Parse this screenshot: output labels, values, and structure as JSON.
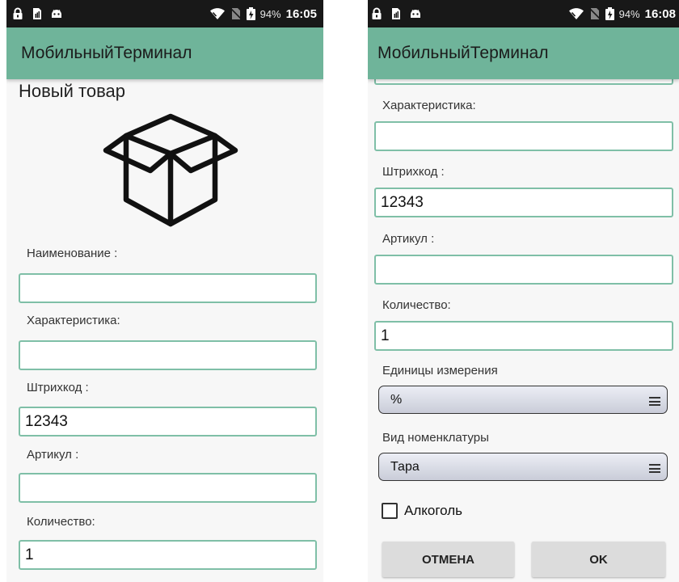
{
  "left": {
    "status": {
      "battery": "94%",
      "time": "16:05"
    },
    "app_title": "МобильныйТерминал",
    "page_title": "Новый товар",
    "fields": [
      {
        "label": "Наименование :",
        "value": ""
      },
      {
        "label": "Характеристика:",
        "value": ""
      },
      {
        "label": "Штрихкод :",
        "value": "12343"
      },
      {
        "label": "Артикул :",
        "value": ""
      },
      {
        "label": "Количество:",
        "value": "1"
      }
    ]
  },
  "right": {
    "status": {
      "battery": "94%",
      "time": "16:08"
    },
    "app_title": "МобильныйТерминал",
    "fields": [
      {
        "label": "Характеристика:",
        "value": ""
      },
      {
        "label": "Штрихкод :",
        "value": "12343"
      },
      {
        "label": "Артикул :",
        "value": ""
      },
      {
        "label": "Количество:",
        "value": "1"
      }
    ],
    "units": {
      "label": "Единицы измерения",
      "value": "%"
    },
    "nomenclature": {
      "label": "Вид номенклатуры",
      "value": "Тара"
    },
    "alcohol": {
      "label": "Алкоголь",
      "checked": false
    },
    "buttons": {
      "cancel": "ОТМЕНА",
      "ok": "OK"
    }
  },
  "icons": {
    "status_left": [
      "lock-icon",
      "sim-icon",
      "android-icon"
    ],
    "status_right": [
      "wifi-icon",
      "no-sim-icon",
      "battery-icon"
    ],
    "product": "box-icon",
    "spinner": "menu-icon"
  },
  "colors": {
    "app_bar": "#6fb49a",
    "field_border": "#7fbfa7",
    "status_bar": "#181818",
    "background": "#f7f7f7"
  }
}
